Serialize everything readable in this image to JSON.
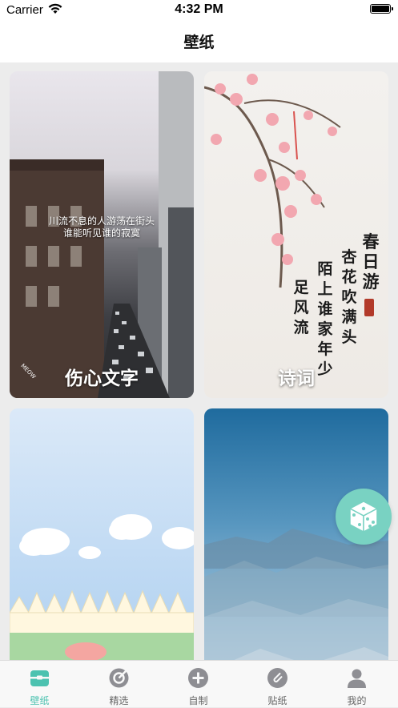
{
  "status_bar": {
    "carrier": "Carrier",
    "time": "4:32 PM"
  },
  "nav": {
    "title": "壁纸"
  },
  "cards": [
    {
      "label": "伤心文字",
      "overlay_lines": [
        "川流不息的人游荡在街头",
        "谁能听见谁的寂寞"
      ],
      "corner_text": "MEOW"
    },
    {
      "label": "诗词",
      "poem_columns": [
        "春日游",
        "杏花吹满头",
        "陌上谁家年少",
        "足风流"
      ]
    },
    {
      "label": ""
    },
    {
      "label": ""
    }
  ],
  "tabs": [
    {
      "label": "壁纸",
      "icon": "wallpaper-icon",
      "active": true
    },
    {
      "label": "精选",
      "icon": "compass-icon",
      "active": false
    },
    {
      "label": "自制",
      "icon": "plus-icon",
      "active": false
    },
    {
      "label": "贴纸",
      "icon": "paperclip-icon",
      "active": false
    },
    {
      "label": "我的",
      "icon": "person-icon",
      "active": false
    }
  ],
  "colors": {
    "accent": "#4cc2b0",
    "fab": "#79d2c2",
    "tab_inactive": "#8e8e93"
  }
}
